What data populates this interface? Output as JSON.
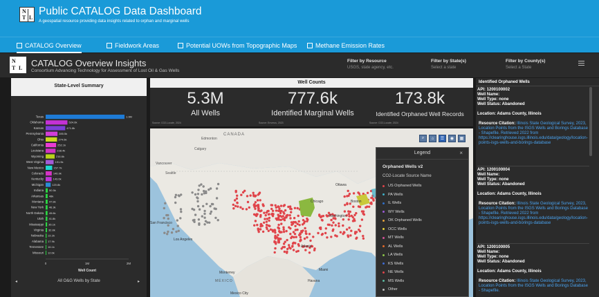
{
  "app": {
    "title": "Public CATALOG Data Dashboard",
    "subtitle": "A geospatial resource providing data insights related to orphan and marginal wells",
    "logo_text": "NTL"
  },
  "nav": {
    "tabs": [
      {
        "label": "CATALOG Overview",
        "active": true
      },
      {
        "label": "Fieldwork Areas"
      },
      {
        "label": "Potential UOWs from Topographic Maps"
      },
      {
        "label": "Methane Emission Rates"
      }
    ]
  },
  "overview": {
    "title": "CATALOG Overview Insights",
    "subtitle": "Consortium Advancing Technology for Assessment of Lost Oil & Gas Wells"
  },
  "filters": [
    {
      "label": "Filter by Resource",
      "value": "USGS, state agency, etc."
    },
    {
      "label": "Filter by State(s)",
      "value": "Select a state"
    },
    {
      "label": "Filter by County(s)",
      "value": "Select a State"
    }
  ],
  "state_summary": {
    "title": "State-Level Summary",
    "x_label": "Well Count",
    "footer": "All O&G Wells by State"
  },
  "chart_data": {
    "type": "bar",
    "orientation": "horizontal",
    "categories": [
      "Texas",
      "Oklahoma",
      "Kansas",
      "Pennsylvania",
      "Ohio",
      "California",
      "Louisiana",
      "Wyoming",
      "West Virginia",
      "New Mexico",
      "Colorado",
      "Kentucky",
      "Michigan",
      "Indiana",
      "Arkansas",
      "Montana",
      "New York",
      "North Dakota",
      "Utah",
      "Mississippi",
      "Virginia",
      "Nebraska",
      "Alabama",
      "Tennessee",
      "Missouri"
    ],
    "values": [
      1900000,
      524600,
      471800,
      285500,
      274600,
      252100,
      238400,
      216600,
      191900,
      157700,
      146900,
      143600,
      120800,
      50500,
      48000,
      47800,
      46300,
      45600,
      41800,
      36100,
      32800,
      22200,
      17900,
      16100,
      12600
    ],
    "labels": [
      "1.9M",
      "524.6k",
      "471.8k",
      "285.5k",
      "274.6k",
      "252.1k",
      "238.4k",
      "216.6k",
      "191.9k",
      "157.7k",
      "146.9k",
      "143.6k",
      "120.8k",
      "50.5k",
      "48k",
      "47.8k",
      "46.3k",
      "45.6k",
      "41.8k",
      "36.1k",
      "32.8k",
      "22.2k",
      "17.9k",
      "16.1k",
      "12.6k"
    ],
    "colors": [
      "#1e7bd6",
      "#c531d6",
      "#7d3fd8",
      "#d13ed8",
      "#c9d91e",
      "#ea3bd3",
      "#d032c4",
      "#b9d21b",
      "#a35bd6",
      "#1ed7d1",
      "#d533c4",
      "#bf36d8",
      "#2a8bd6",
      "#2bd643",
      "#2bd643",
      "#2bd643",
      "#2bd643",
      "#2bd643",
      "#2bd643",
      "#2bd643",
      "#2bd643",
      "#2bd643",
      "#2bd643",
      "#2bd643",
      "#2bd643"
    ],
    "x_ticks": [
      "0",
      "1M",
      "2M"
    ],
    "xlim": [
      0,
      2000000
    ]
  },
  "well_counts": {
    "title": "Well Counts",
    "stats": [
      {
        "value": "5.3M",
        "label": "All Wells",
        "source": "Source: CO2-Locate, 2024"
      },
      {
        "value": "777.6k",
        "label": "Identified Marginal Wells",
        "source": "Source: Enverus, 2023"
      },
      {
        "value": "173.8k",
        "label": "Identified Orphaned Well Records",
        "source": "Source: CO2-Locate, 2024"
      }
    ]
  },
  "map": {
    "labels": {
      "canada": "CANADA",
      "edmonton": "Edmonton",
      "calgary": "Calgary",
      "vancouver": "Vancouver",
      "seattle": "Seattle",
      "ottawa": "Ottawa",
      "boston": "Boston",
      "chicago": "Chicago",
      "washington": "Washington",
      "sanfrancisco": "San Francisco",
      "losangeles": "Los Angeles",
      "atlanta": "Atlanta",
      "monterrey": "Monterrey",
      "miami": "Miami",
      "havana": "Havana",
      "mexico": "MÉXICO",
      "mexicocity": "Mexico City"
    }
  },
  "legend": {
    "title": "Legend",
    "layer": "Orphaned Wells v2",
    "field": "CO2-Locate Source Name",
    "items": [
      {
        "label": "US Orphaned Wells",
        "color": "#e0444a"
      },
      {
        "label": "PA Wells",
        "color": "#3fb0c7"
      },
      {
        "label": "IL Wells",
        "color": "#3070c9"
      },
      {
        "label": "WY Wells",
        "color": "#9b59d6"
      },
      {
        "label": "OK Orphaned Wells",
        "color": "#e6a23c"
      },
      {
        "label": "OCC Wells",
        "color": "#e6d23c"
      },
      {
        "label": "MT Wells",
        "color": "#d7519a"
      },
      {
        "label": "AL Wells",
        "color": "#e36a2b"
      },
      {
        "label": "LA Wells",
        "color": "#8bc34a"
      },
      {
        "label": "KS Wells",
        "color": "#3f6bd6"
      },
      {
        "label": "NE Wells",
        "color": "#e0444a"
      },
      {
        "label": "MS Wells",
        "color": "#5bb8a0"
      },
      {
        "label": "Other",
        "color": "#bdbdbd"
      }
    ]
  },
  "wells_panel": {
    "title": "Identified Orphaned Wells",
    "cards": [
      {
        "api": "API: 1200100002",
        "name": "Well Name:",
        "type": "Well Type: none",
        "status": "Well Status: Abandoned",
        "location": "Location: Adams County, Illinois",
        "cite_label": "Resource Citation:",
        "citation": "Illinois State Geological Survey, 2023, Location Points from the ISGS Wells and Borings Database - Shapefile. Retrieved 2022 from https://clearinghouse.isgs.illinois.edu/data/geology/location-points-isgs-wells-and-borings-database"
      },
      {
        "api": "API: 1200100004",
        "name": "Well Name:",
        "type": "Well Type: none",
        "status": "Well Status: Abandoned",
        "location": "Location: Adams County, Illinois",
        "cite_label": "Resource Citation:",
        "citation": "Illinois State Geological Survey, 2023, Location Points from the ISGS Wells and Borings Database - Shapefile. Retrieved 2022 from https://clearinghouse.isgs.illinois.edu/data/geology/location-points-isgs-wells-and-borings-database"
      },
      {
        "api": "API: 1200100005",
        "name": "Well Name:",
        "type": "Well Type: none",
        "status": "Well Status: Abandoned",
        "location": "Location: Adams County, Illinois",
        "cite_label": "Resource Citation:",
        "citation": "Illinois State Geological Survey, 2023, Location Points from the ISGS Wells and Borings Database - Shapefile."
      }
    ]
  }
}
